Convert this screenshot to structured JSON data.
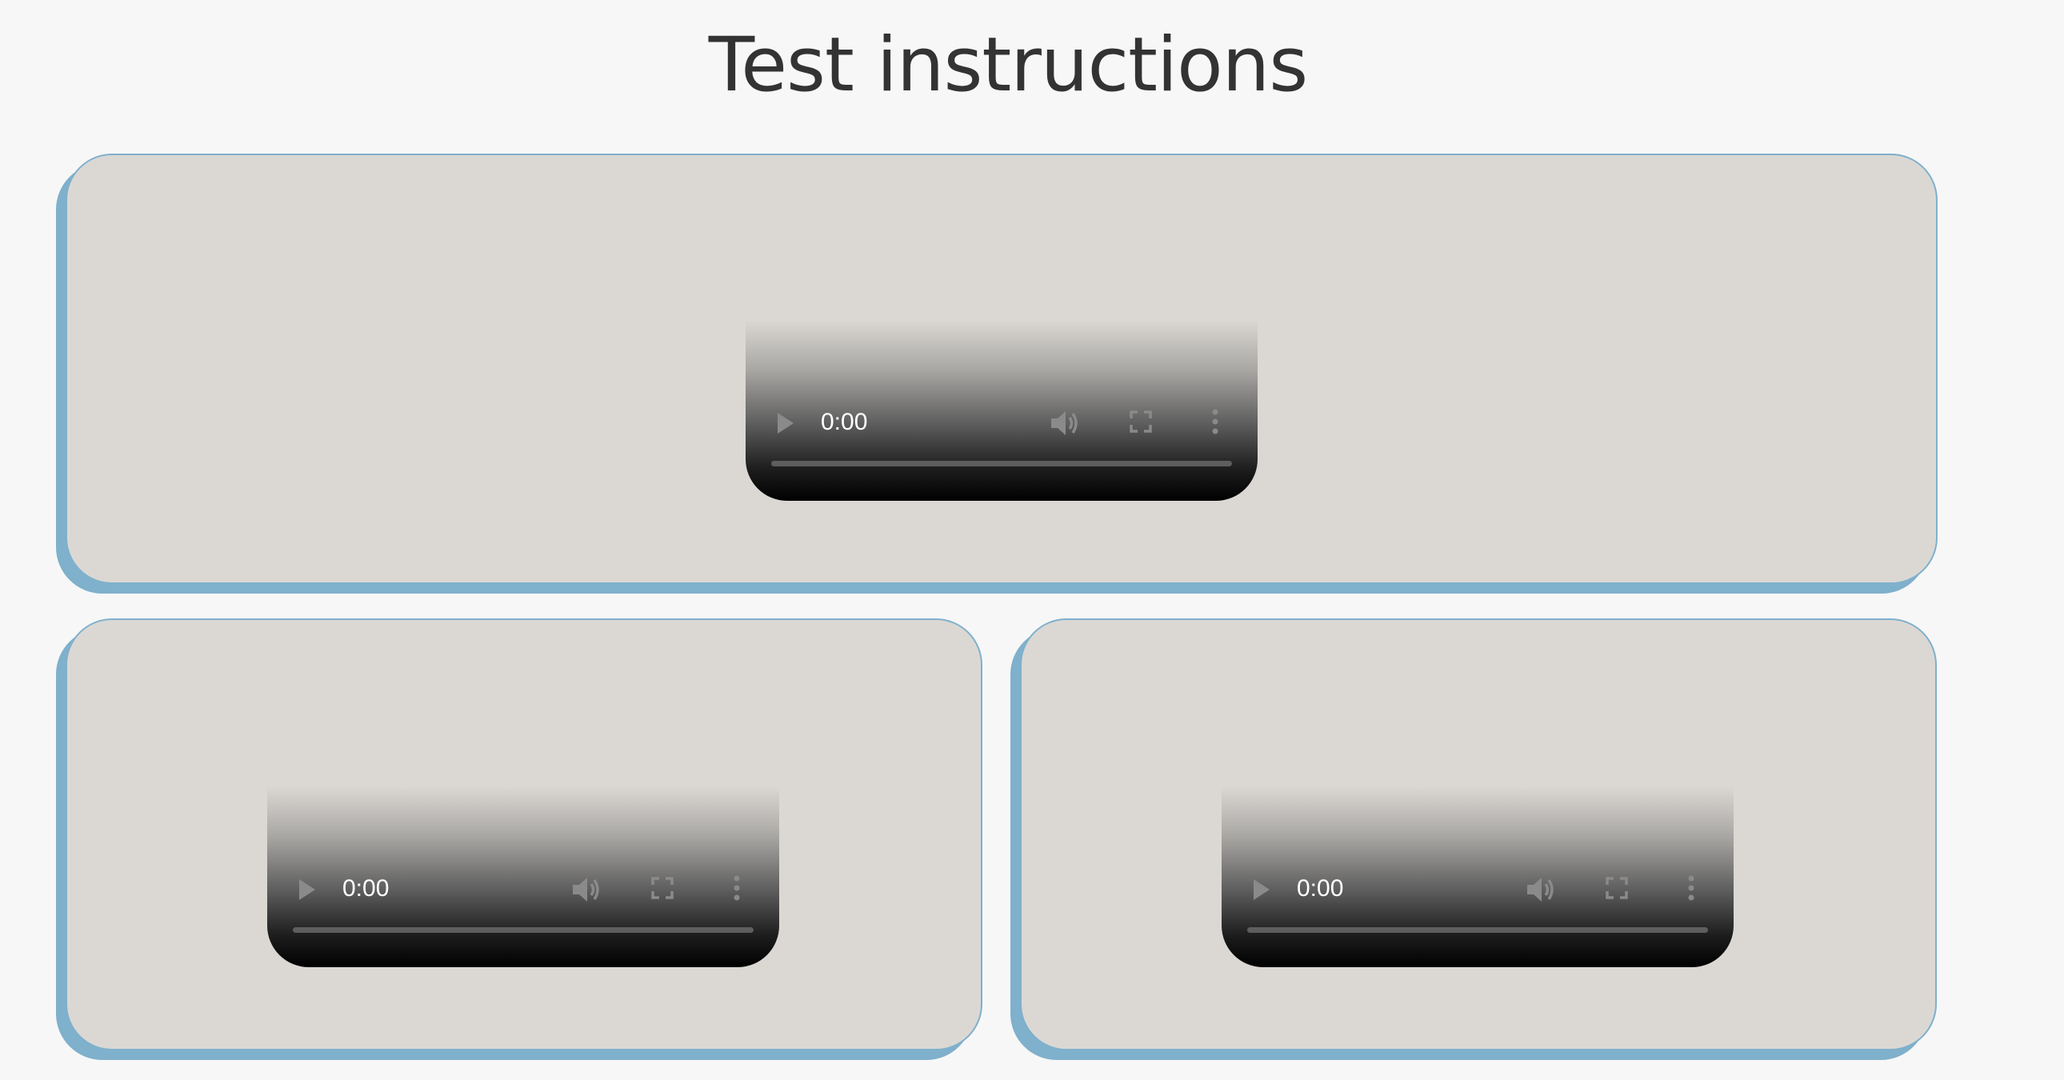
{
  "page": {
    "title": "Test instructions"
  },
  "players": [
    {
      "time": "0:00"
    },
    {
      "time": "0:00"
    },
    {
      "time": "0:00"
    }
  ],
  "colors": {
    "background": "#f7f7f7",
    "card_fill": "#dbd8d4",
    "card_accent": "#7fb0cc",
    "title_text": "#333333",
    "player_dark": "#000000"
  },
  "icons": [
    "play-icon",
    "volume-icon",
    "fullscreen-icon",
    "more-options-icon"
  ]
}
